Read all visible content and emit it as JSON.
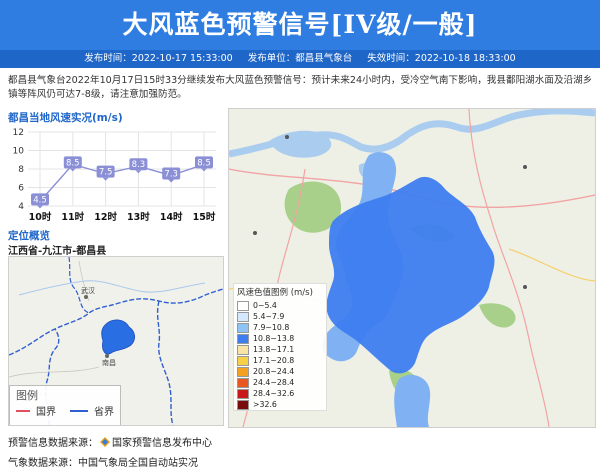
{
  "header": {
    "title": "大风蓝色预警信号[IV级/一般]",
    "publish_time": "发布时间：2022-10-17 15:33:00",
    "publish_unit": "发布单位：都昌县气象台",
    "expire_time": "失效时间：2022-10-18 18:33:00"
  },
  "description": "都昌县气象台2022年10月17日15时33分继续发布大风蓝色预警信号：预计未来24小时内，受冷空气南下影响，我县鄱阳湖水面及沿湖乡镇等阵风仍可达7-8级，请注意加强防范。",
  "wind_panel": {
    "title": "都昌当地风速实况(m/s)"
  },
  "chart_data": {
    "type": "line",
    "title": "都昌当地风速实况(m/s)",
    "categories": [
      "10时",
      "11时",
      "12时",
      "13时",
      "14时",
      "15时"
    ],
    "series": [
      {
        "values": [
          4.5,
          8.5,
          7.5,
          8.3,
          7.3,
          8.5
        ]
      }
    ],
    "yticks": [
      4,
      6,
      8,
      10,
      12
    ],
    "ylim": [
      4,
      12
    ],
    "grid": true,
    "colors": {
      "line": "#8a8fd6",
      "label_bg": "#8a8fd6"
    }
  },
  "location_panel": {
    "title": "定位概览",
    "region": "江西省-九江市-都昌县",
    "place_wuhan": "武汉",
    "place_nanchang": "南昌",
    "legend_title": "图例",
    "legend_items": [
      {
        "label": "国界",
        "color": "#e05060"
      },
      {
        "label": "省界",
        "color": "#2f5fd0"
      }
    ]
  },
  "wind_legend": {
    "title": "风速色值图例 (m/s)",
    "items": [
      {
        "label": "0~5.4",
        "color": "#ffffff"
      },
      {
        "label": "5.4~7.9",
        "color": "#d4e8ff"
      },
      {
        "label": "7.9~10.8",
        "color": "#8cc4f8"
      },
      {
        "label": "10.8~13.8",
        "color": "#3e7df0"
      },
      {
        "label": "13.8~17.1",
        "color": "#f8e4a4"
      },
      {
        "label": "17.1~20.8",
        "color": "#f8d048"
      },
      {
        "label": "20.8~24.4",
        "color": "#f4a020"
      },
      {
        "label": "24.4~28.4",
        "color": "#e85820"
      },
      {
        "label": "28.4~32.6",
        "color": "#c81818"
      },
      {
        "label": ">32.6",
        "color": "#7a0c0c"
      }
    ]
  },
  "sources": {
    "warning_label": "预警信息数据来源：",
    "warning_value": "国家预警信息发布中心",
    "weather_label": "气象数据来源：",
    "weather_value": "中国气象局全国自动站实况"
  },
  "colors": {
    "header_bg": "#2f7de1",
    "meta_bg": "#1f66c9",
    "accent": "#1f66c9"
  }
}
